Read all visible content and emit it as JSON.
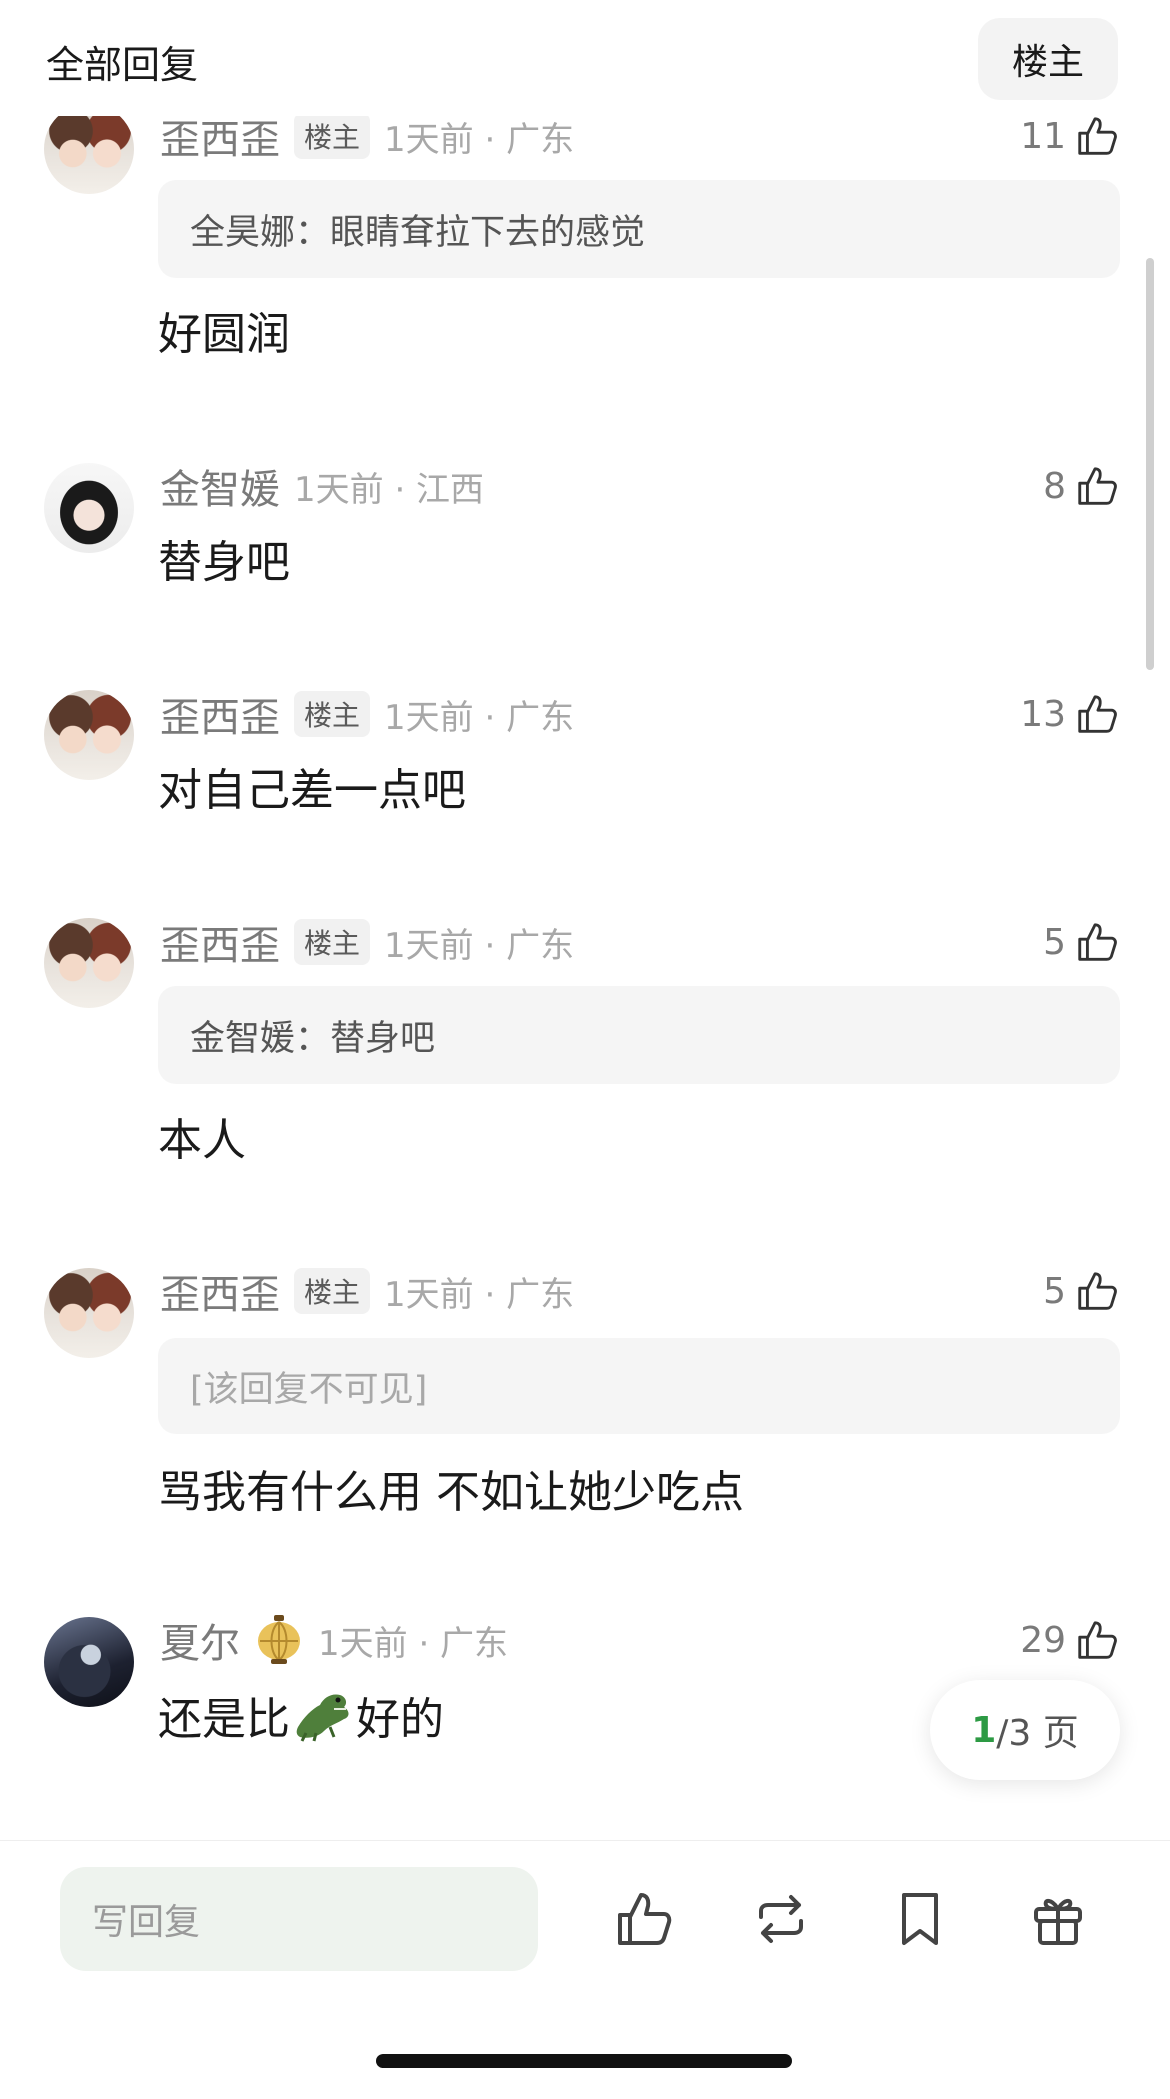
{
  "header": {
    "title": "全部回复",
    "op_filter_label": "楼主"
  },
  "comments": [
    {
      "username": "歪西歪",
      "op_badge": "楼主",
      "time_location": "1天前 · 广东",
      "likes": "11",
      "quote": "全昊娜：眼睛耷拉下去的感觉",
      "text": "好圆润"
    },
    {
      "username": "金智媛",
      "time_location": "1天前 · 江西",
      "likes": "8",
      "text": "替身吧"
    },
    {
      "username": "歪西歪",
      "op_badge": "楼主",
      "time_location": "1天前 · 广东",
      "likes": "13",
      "text": "对自己差一点吧"
    },
    {
      "username": "歪西歪",
      "op_badge": "楼主",
      "time_location": "1天前 · 广东",
      "likes": "5",
      "quote": "金智媛：替身吧",
      "text": "本人"
    },
    {
      "username": "歪西歪",
      "op_badge": "楼主",
      "time_location": "1天前 · 广东",
      "likes": "5",
      "quote": "[该回复不可见]",
      "text": "骂我有什么用 不如让她少吃点"
    },
    {
      "username": "夏尔",
      "time_location": "1天前 · 广东",
      "likes": "29",
      "text_before": "还是比",
      "text_after": "好的"
    }
  ],
  "pagination": {
    "current": "1",
    "total": "/3 页"
  },
  "bottom_bar": {
    "reply_placeholder": "写回复"
  },
  "icons": [
    "thumbs-up-icon",
    "repost-icon",
    "bookmark-icon",
    "gift-icon",
    "lantern-emoji",
    "crocodile-emoji"
  ],
  "colors": {
    "accent_green": "#2d9a44",
    "muted_text": "#a8a8a8",
    "quote_bg": "#f5f5f5"
  }
}
